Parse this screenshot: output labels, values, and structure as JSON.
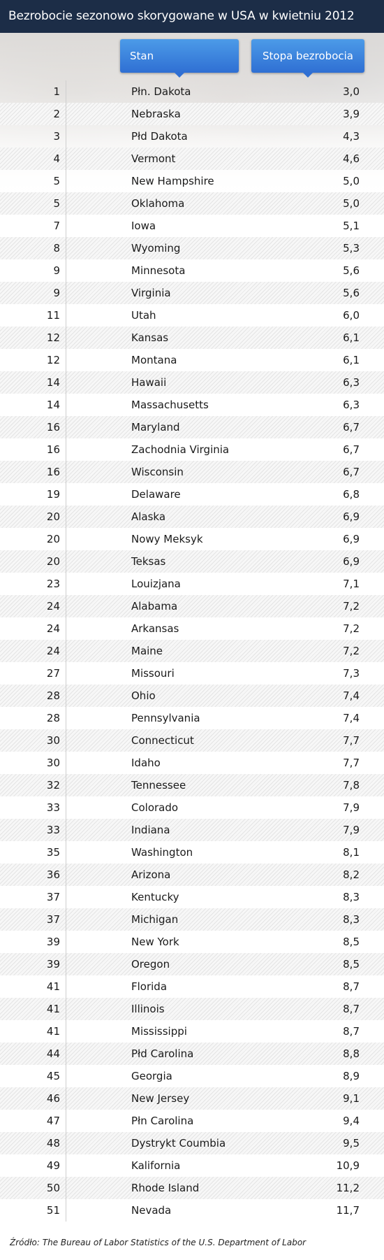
{
  "title": "Bezrobocie sezonowo skorygowane w USA w kwietniu 2012",
  "header": {
    "state_label": "Stan",
    "rate_label": "Stopa bezrobocia"
  },
  "source": "Źródło: The Bureau of Labor Statistics of the U.S. Department of Labor",
  "colors": {
    "title_bg": "#1c2d47",
    "header_pill": "#3a86e0"
  },
  "chart_data": {
    "type": "table",
    "title": "Bezrobocie sezonowo skorygowane w USA w kwietniu 2012",
    "columns": [
      "",
      "Stan",
      "Stopa bezrobocia"
    ],
    "rows": [
      {
        "rank": "1",
        "state": "Płn. Dakota",
        "rate": "3,0"
      },
      {
        "rank": "2",
        "state": "Nebraska",
        "rate": "3,9"
      },
      {
        "rank": "3",
        "state": "Płd Dakota",
        "rate": "4,3"
      },
      {
        "rank": "4",
        "state": "Vermont",
        "rate": "4,6"
      },
      {
        "rank": "5",
        "state": "New Hampshire",
        "rate": "5,0"
      },
      {
        "rank": "5",
        "state": "Oklahoma",
        "rate": "5,0"
      },
      {
        "rank": "7",
        "state": "Iowa",
        "rate": "5,1"
      },
      {
        "rank": "8",
        "state": "Wyoming",
        "rate": "5,3"
      },
      {
        "rank": "9",
        "state": "Minnesota",
        "rate": "5,6"
      },
      {
        "rank": "9",
        "state": "Virginia",
        "rate": "5,6"
      },
      {
        "rank": "11",
        "state": "Utah",
        "rate": "6,0"
      },
      {
        "rank": "12",
        "state": "Kansas",
        "rate": "6,1"
      },
      {
        "rank": "12",
        "state": "Montana",
        "rate": "6,1"
      },
      {
        "rank": "14",
        "state": "Hawaii",
        "rate": "6,3"
      },
      {
        "rank": "14",
        "state": "Massachusetts",
        "rate": "6,3"
      },
      {
        "rank": "16",
        "state": "Maryland",
        "rate": "6,7"
      },
      {
        "rank": "16",
        "state": "Zachodnia Virginia",
        "rate": "6,7"
      },
      {
        "rank": "16",
        "state": "Wisconsin",
        "rate": "6,7"
      },
      {
        "rank": "19",
        "state": "Delaware",
        "rate": "6,8"
      },
      {
        "rank": "20",
        "state": "Alaska",
        "rate": "6,9"
      },
      {
        "rank": "20",
        "state": "Nowy Meksyk",
        "rate": "6,9"
      },
      {
        "rank": "20",
        "state": "Teksas",
        "rate": "6,9"
      },
      {
        "rank": "23",
        "state": "Louizjana",
        "rate": "7,1"
      },
      {
        "rank": "24",
        "state": "Alabama",
        "rate": "7,2"
      },
      {
        "rank": "24",
        "state": "Arkansas",
        "rate": "7,2"
      },
      {
        "rank": "24",
        "state": "Maine",
        "rate": "7,2"
      },
      {
        "rank": "27",
        "state": "Missouri",
        "rate": "7,3"
      },
      {
        "rank": "28",
        "state": "Ohio",
        "rate": "7,4"
      },
      {
        "rank": "28",
        "state": "Pennsylvania",
        "rate": "7,4"
      },
      {
        "rank": "30",
        "state": "Connecticut",
        "rate": "7,7"
      },
      {
        "rank": "30",
        "state": "Idaho",
        "rate": "7,7"
      },
      {
        "rank": "32",
        "state": "Tennessee",
        "rate": "7,8"
      },
      {
        "rank": "33",
        "state": "Colorado",
        "rate": "7,9"
      },
      {
        "rank": "33",
        "state": "Indiana",
        "rate": "7,9"
      },
      {
        "rank": "35",
        "state": "Washington",
        "rate": "8,1"
      },
      {
        "rank": "36",
        "state": "Arizona",
        "rate": "8,2"
      },
      {
        "rank": "37",
        "state": "Kentucky",
        "rate": "8,3"
      },
      {
        "rank": "37",
        "state": "Michigan",
        "rate": "8,3"
      },
      {
        "rank": "39",
        "state": "New York",
        "rate": "8,5"
      },
      {
        "rank": "39",
        "state": "Oregon",
        "rate": "8,5"
      },
      {
        "rank": "41",
        "state": "Florida",
        "rate": "8,7"
      },
      {
        "rank": "41",
        "state": "Illinois",
        "rate": "8,7"
      },
      {
        "rank": "41",
        "state": "Mississippi",
        "rate": "8,7"
      },
      {
        "rank": "44",
        "state": "Płd Carolina",
        "rate": "8,8"
      },
      {
        "rank": "45",
        "state": "Georgia",
        "rate": "8,9"
      },
      {
        "rank": "46",
        "state": "New Jersey",
        "rate": "9,1"
      },
      {
        "rank": "47",
        "state": "Płn Carolina",
        "rate": "9,4"
      },
      {
        "rank": "48",
        "state": "Dystrykt Coumbia",
        "rate": "9,5"
      },
      {
        "rank": "49",
        "state": "Kalifornia",
        "rate": "10,9"
      },
      {
        "rank": "50",
        "state": "Rhode Island",
        "rate": "11,2"
      },
      {
        "rank": "51",
        "state": "Nevada",
        "rate": "11,7"
      }
    ]
  }
}
